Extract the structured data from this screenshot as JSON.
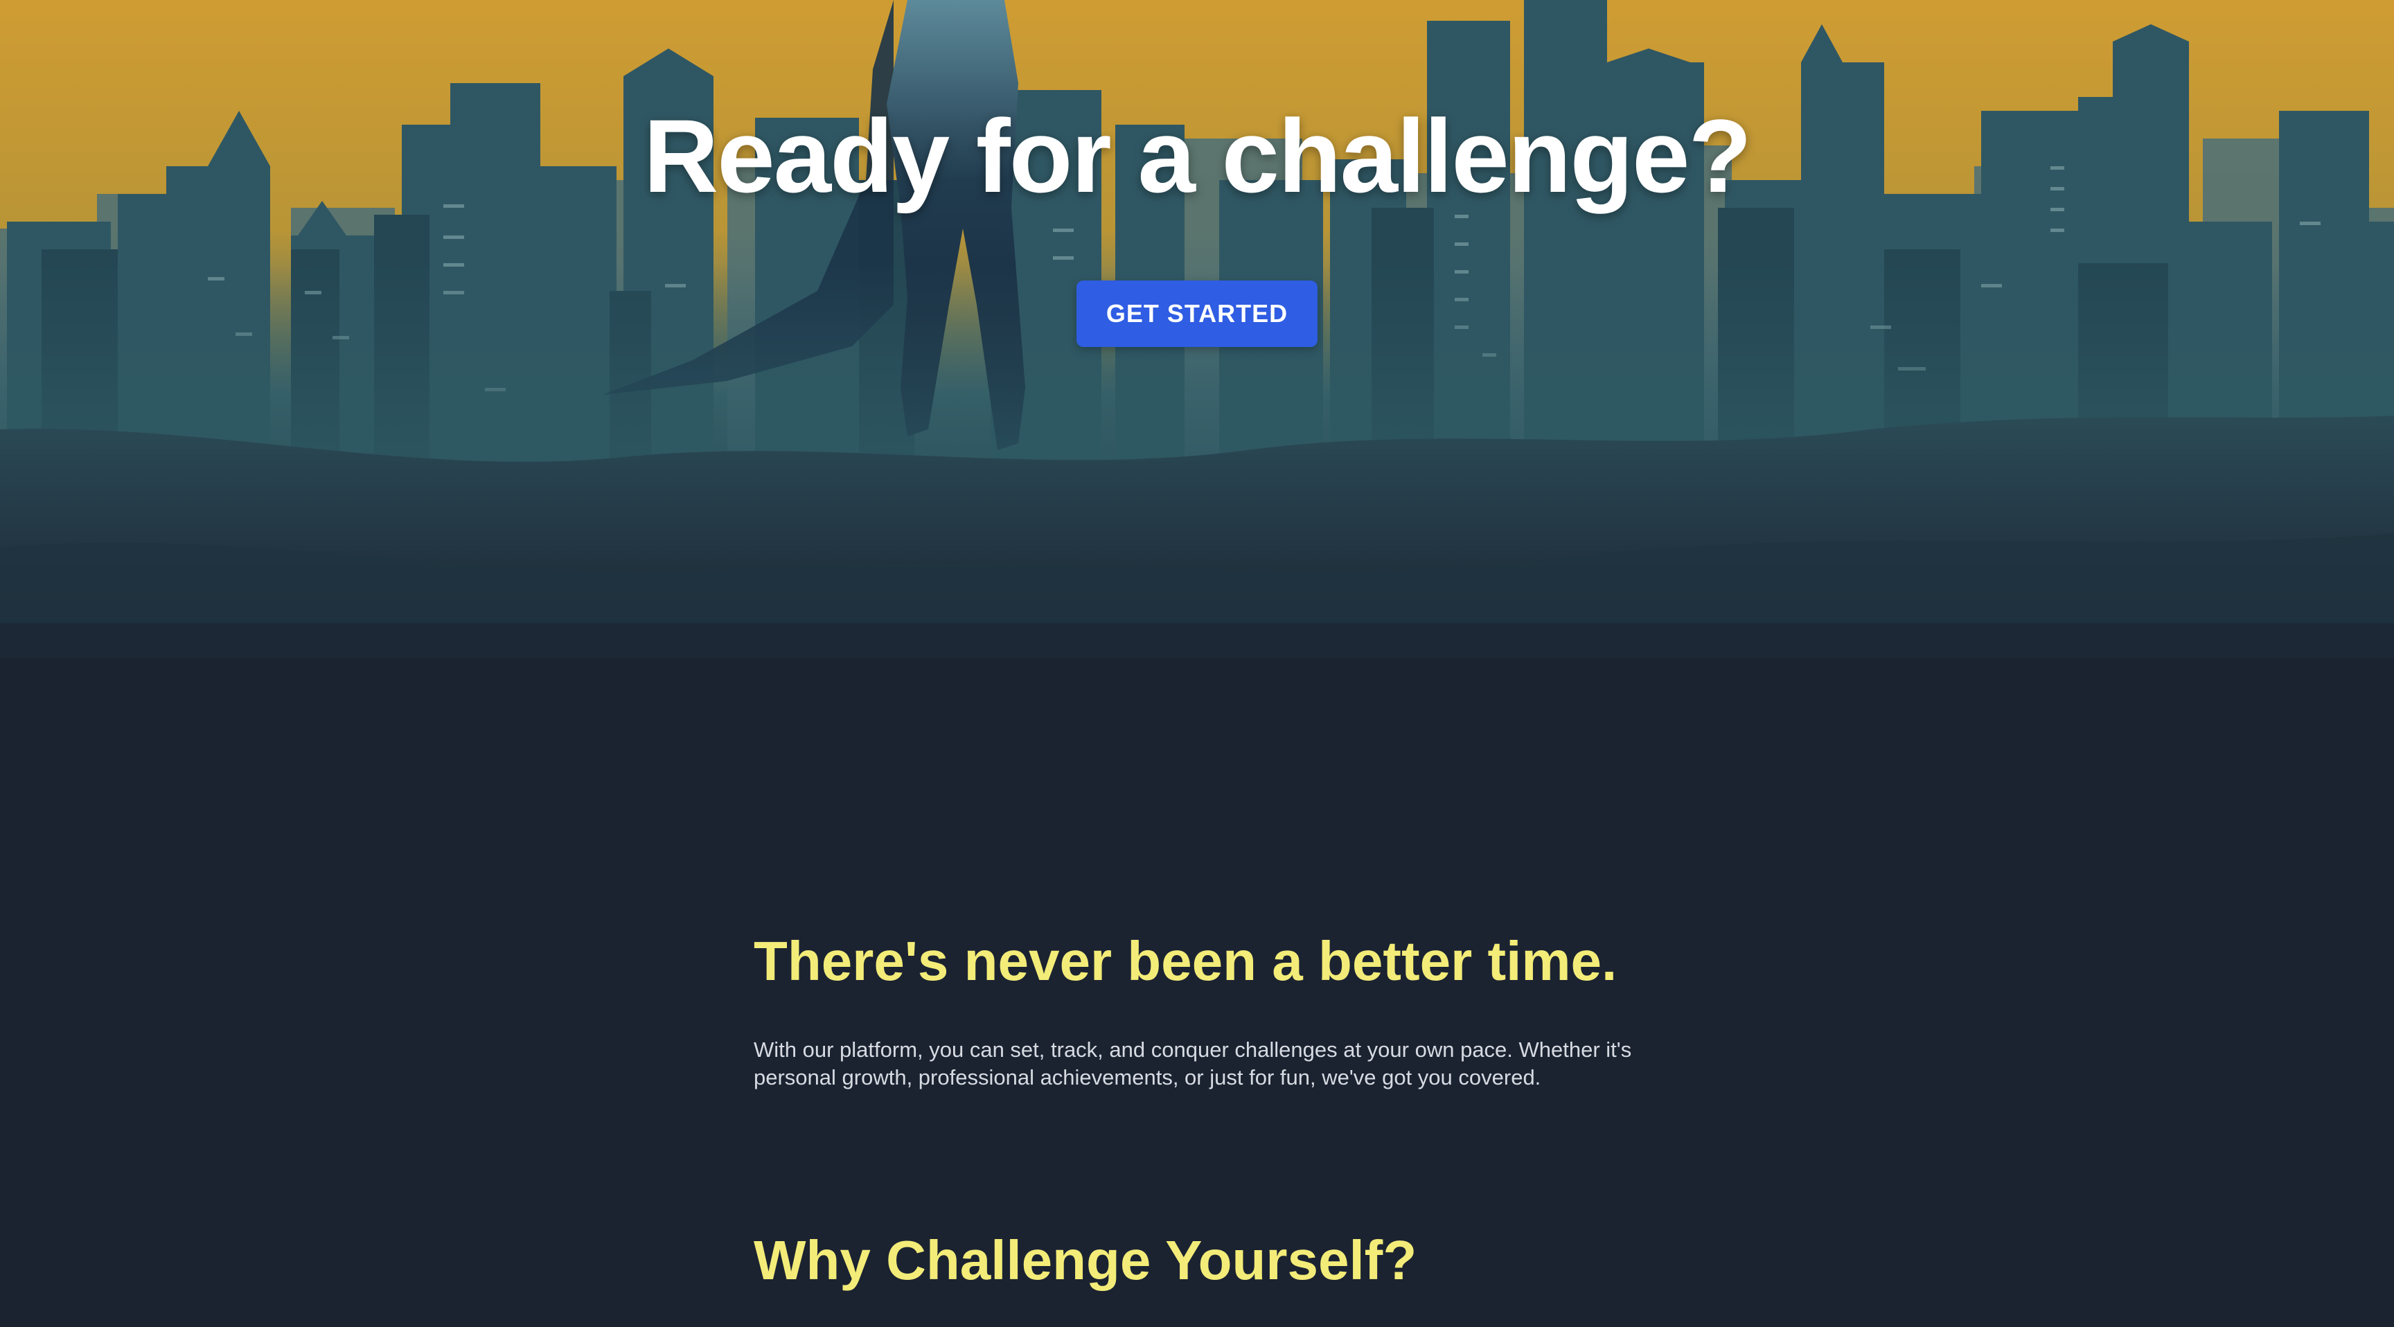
{
  "hero": {
    "title": "Ready for a challenge?",
    "cta_label": "GET STARTED"
  },
  "sections": [
    {
      "title": "There's never been a better time.",
      "body": "With our platform, you can set, track, and conquer challenges at your own pace. Whether it's personal growth, professional achievements, or just for fun, we've got you covered."
    },
    {
      "title": "Why Challenge Yourself?"
    }
  ],
  "colors": {
    "background": "#1b2331",
    "sky": "#d6a236",
    "buildings": "#2a4a58",
    "accent_heading": "#f3ec78",
    "button": "#2f5de3"
  },
  "icons": [
    "city-skyline-illustration",
    "caped-hero-silhouette"
  ]
}
